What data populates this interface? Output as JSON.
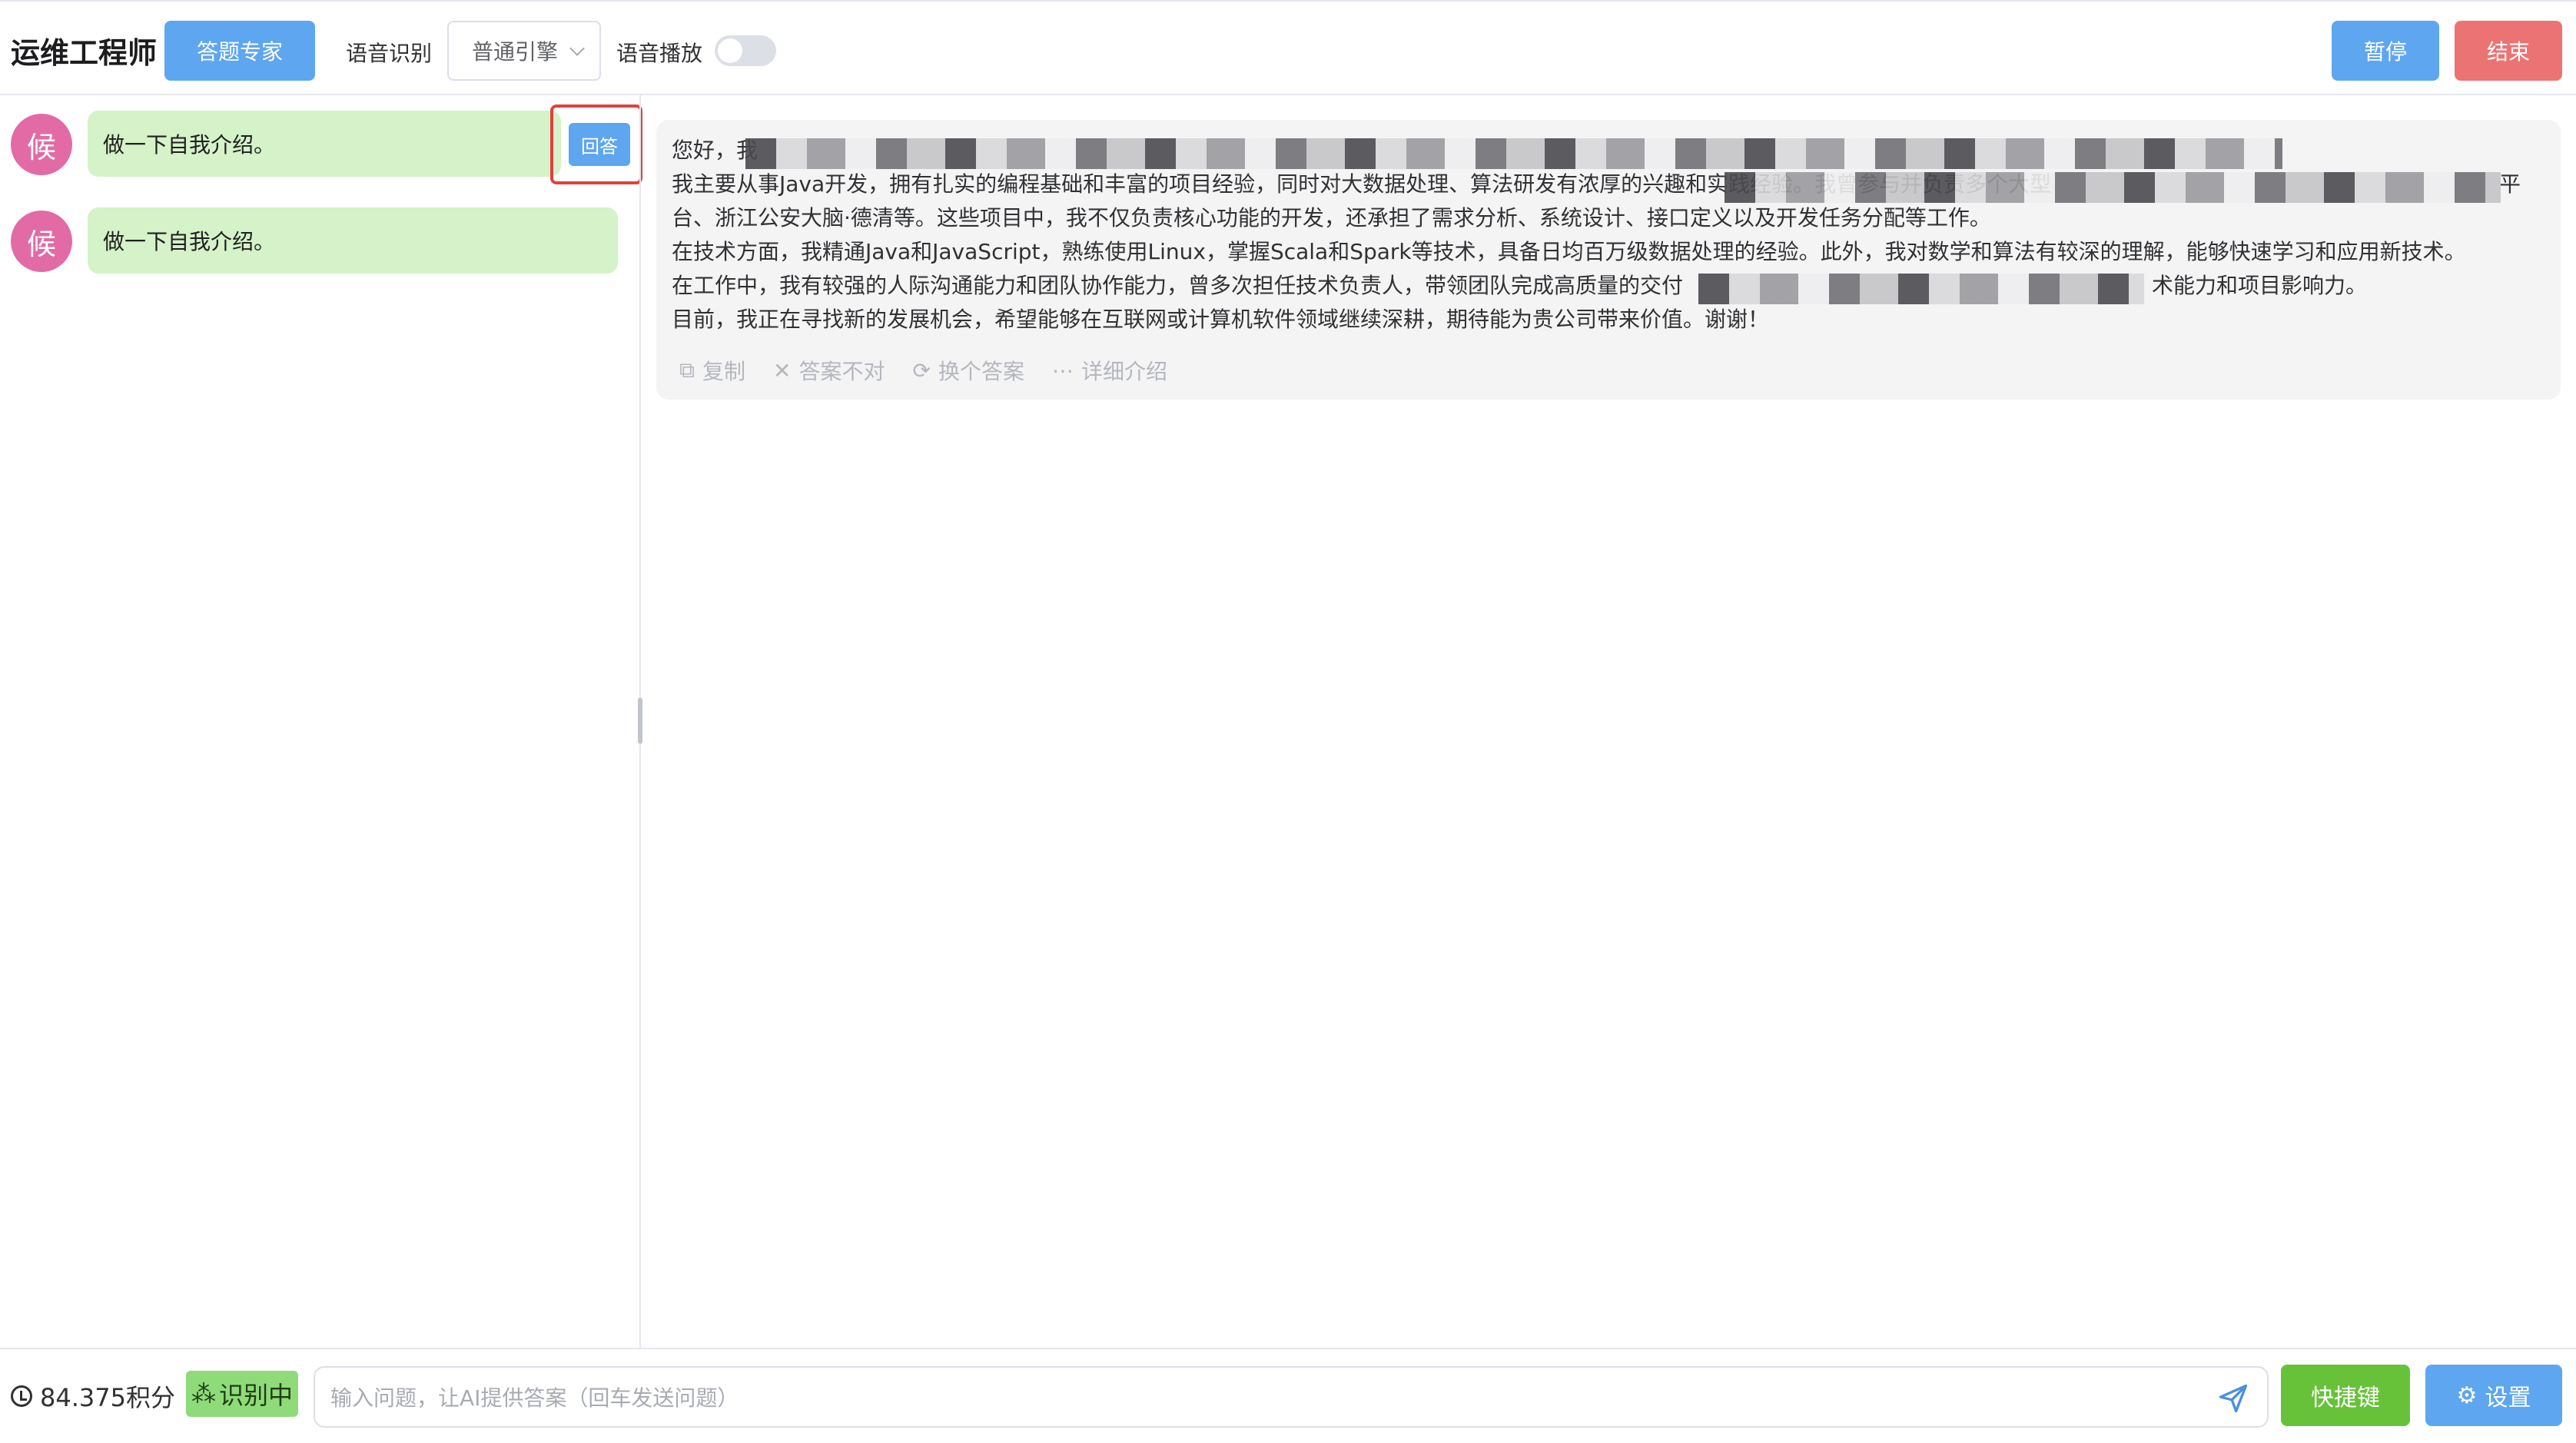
{
  "header": {
    "title": "运维工程师",
    "expert_button": "答题专家",
    "asr_label": "语音识别",
    "engine_select": "普通引擎",
    "tts_label": "语音播放",
    "tts_enabled": false,
    "pause_button": "暂停",
    "end_button": "结束"
  },
  "questions": [
    {
      "avatar": "候",
      "text": "做一下自我介绍。",
      "answer_button": "回答"
    },
    {
      "avatar": "候",
      "text": "做一下自我介绍。"
    }
  ],
  "answer": {
    "lines": [
      "您好，我",
      "我主要从事Java开发，拥有扎实的编程基础和丰富的项目经验，同时对大数据处理、算法研发有浓厚的兴趣和实践经验。我曾参与并负责多个大型",
      "台、浙江公安大脑·德清等。这些项目中，我不仅负责核心功能的开发，还承担了需求分析、系统设计、接口定义以及开发任务分配等工作。",
      "在技术方面，我精通Java和JavaScript，熟练使用Linux，掌握Scala和Spark等技术，具备日均百万级数据处理的经验。此外，我对数学和算法有较深的理解，能够快速学习和应用新技术。",
      "在工作中，我有较强的人际沟通能力和团队协作能力，曾多次担任技术负责人，带领团队完成高质量的交付",
      "目前，我正在寻找新的发展机会，希望能够在互联网或计算机软件领域继续深耕，期待能为贵公司带来价值。谢谢！"
    ],
    "line2_tail": "平",
    "line5_tail": "术能力和项目影响力。",
    "actions": {
      "copy": "复制",
      "wrong": "答案不对",
      "another": "换个答案",
      "detail": "详细介绍"
    }
  },
  "footer": {
    "credits": "84.375积分",
    "recognizing": "识别中",
    "input_placeholder": "输入问题，让AI提供答案（回车发送问题）",
    "shortcut_button": "快捷键",
    "settings_button": "设置"
  }
}
